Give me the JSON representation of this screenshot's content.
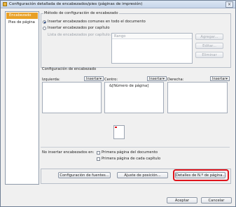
{
  "window": {
    "title": "Configuración detallada de encabezados/pies (páginas de impresión)"
  },
  "sidebar": {
    "items": [
      {
        "label": "Encabezado",
        "selected": true
      },
      {
        "label": "Pies de página",
        "selected": false
      }
    ]
  },
  "method_group": {
    "label": "Método de configuración de encabezado",
    "option_common": "Insertar encabezados comunes en todo el documento",
    "option_chapter": "Insertar encabezados por capítulo",
    "list_label": "Lista de encabezados por capítulo:",
    "list_header": "Rango",
    "buttons": {
      "add": "Agregar...",
      "edit": "Editar...",
      "delete": "Eliminar"
    }
  },
  "header_config": {
    "label": "Configuración de encabezado",
    "left_label": "Izquierda:",
    "center_label": "Centro:",
    "right_label": "Derecha:",
    "insert_label": "Insertar▾",
    "center_value": "&[Número de página]"
  },
  "no_insert": {
    "label": "No insertar encabezados en:",
    "first_doc": "Primera página del documento",
    "first_chapter": "Primera página de cada capítulo"
  },
  "bottom_buttons": {
    "fonts": "Configuración de fuentes...",
    "position": "Ajuste de posición...",
    "page_number": "Detalles de N.º de página..."
  },
  "dialog_buttons": {
    "ok": "Aceptar",
    "cancel": "Cancelar"
  },
  "colors": {
    "selected_tab": "#e8a026",
    "highlight": "#e0141b"
  }
}
